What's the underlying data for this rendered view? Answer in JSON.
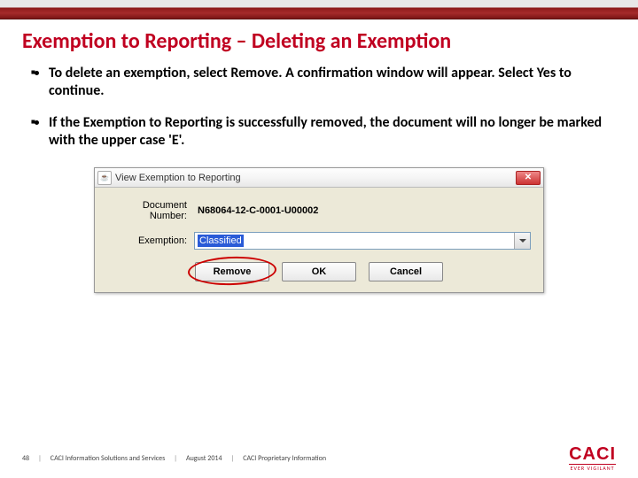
{
  "slide": {
    "title": "Exemption to Reporting – Deleting an Exemption",
    "bullets": [
      "To delete an exemption, select Remove.  A confirmation window will appear.  Select Yes to continue.",
      "If the Exemption to Reporting is successfully removed, the document will no longer be marked with the upper case 'E'."
    ]
  },
  "dialog": {
    "title": "View Exemption to Reporting",
    "java_icon_symbol": "☕",
    "close_symbol": "✕",
    "labels": {
      "document_number": "Document Number:",
      "exemption": "Exemption:"
    },
    "values": {
      "document_number": "N68064-12-C-0001-U00002",
      "exemption": "Classified"
    },
    "buttons": {
      "remove": "Remove",
      "ok": "OK",
      "cancel": "Cancel"
    }
  },
  "footer": {
    "page_number": "48",
    "org": "CACI Information Solutions and Services",
    "date": "August 2014",
    "classification": "CACI Proprietary Information",
    "separator": "|",
    "logo": {
      "text": "CACI",
      "tagline": "EVER VIGILANT"
    }
  }
}
